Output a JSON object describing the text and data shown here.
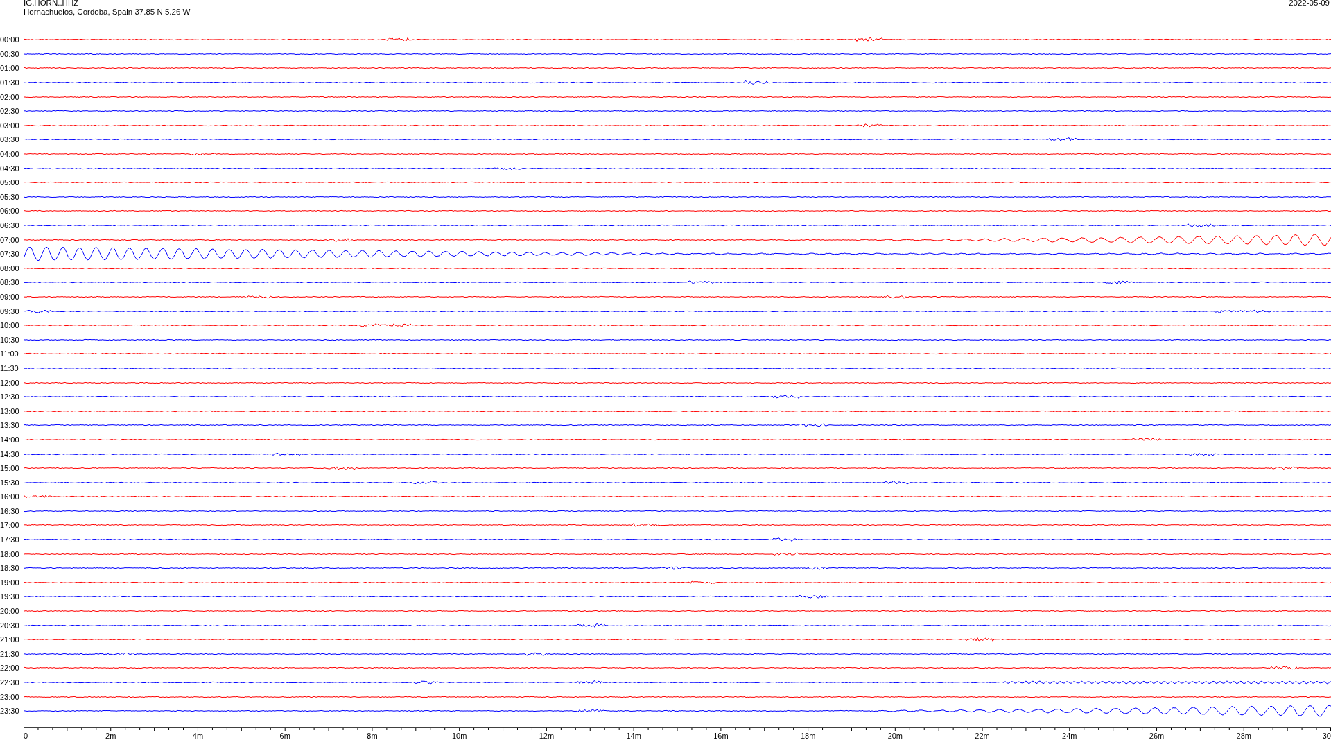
{
  "header": {
    "station": "IG.HORN..HHZ",
    "location": "Hornachuelos, Cordoba, Spain  37.85 N 5.26 W",
    "date": "2022-05-09"
  },
  "rows": [
    {
      "label": "00:00",
      "color": "#ff0000",
      "kind": "quiet"
    },
    {
      "label": "00:30",
      "color": "#0000ff",
      "kind": "quiet"
    },
    {
      "label": "01:00",
      "color": "#ff0000",
      "kind": "quiet"
    },
    {
      "label": "01:30",
      "color": "#0000ff",
      "kind": "quiet"
    },
    {
      "label": "02:00",
      "color": "#ff0000",
      "kind": "quiet"
    },
    {
      "label": "02:30",
      "color": "#0000ff",
      "kind": "quiet"
    },
    {
      "label": "03:00",
      "color": "#ff0000",
      "kind": "quiet"
    },
    {
      "label": "03:30",
      "color": "#0000ff",
      "kind": "quiet"
    },
    {
      "label": "04:00",
      "color": "#ff0000",
      "kind": "quiet"
    },
    {
      "label": "04:30",
      "color": "#0000ff",
      "kind": "quiet"
    },
    {
      "label": "05:00",
      "color": "#ff0000",
      "kind": "quiet"
    },
    {
      "label": "05:30",
      "color": "#0000ff",
      "kind": "quiet"
    },
    {
      "label": "06:00",
      "color": "#ff0000",
      "kind": "quiet"
    },
    {
      "label": "06:30",
      "color": "#0000ff",
      "kind": "quiet"
    },
    {
      "label": "07:00",
      "color": "#ff0000",
      "kind": "rising"
    },
    {
      "label": "07:30",
      "color": "#0000ff",
      "kind": "decaying"
    },
    {
      "label": "08:00",
      "color": "#ff0000",
      "kind": "quiet"
    },
    {
      "label": "08:30",
      "color": "#0000ff",
      "kind": "quiet"
    },
    {
      "label": "09:00",
      "color": "#ff0000",
      "kind": "quiet"
    },
    {
      "label": "09:30",
      "color": "#0000ff",
      "kind": "quiet"
    },
    {
      "label": "10:00",
      "color": "#ff0000",
      "kind": "quiet"
    },
    {
      "label": "10:30",
      "color": "#0000ff",
      "kind": "quiet"
    },
    {
      "label": "11:00",
      "color": "#ff0000",
      "kind": "quiet"
    },
    {
      "label": "11:30",
      "color": "#0000ff",
      "kind": "quiet"
    },
    {
      "label": "12:00",
      "color": "#ff0000",
      "kind": "quiet"
    },
    {
      "label": "12:30",
      "color": "#0000ff",
      "kind": "quiet"
    },
    {
      "label": "13:00",
      "color": "#ff0000",
      "kind": "quiet"
    },
    {
      "label": "13:30",
      "color": "#0000ff",
      "kind": "quiet"
    },
    {
      "label": "14:00",
      "color": "#ff0000",
      "kind": "quiet"
    },
    {
      "label": "14:30",
      "color": "#0000ff",
      "kind": "quiet"
    },
    {
      "label": "15:00",
      "color": "#ff0000",
      "kind": "quiet"
    },
    {
      "label": "15:30",
      "color": "#0000ff",
      "kind": "quiet"
    },
    {
      "label": "16:00",
      "color": "#ff0000",
      "kind": "quiet"
    },
    {
      "label": "16:30",
      "color": "#0000ff",
      "kind": "quiet"
    },
    {
      "label": "17:00",
      "color": "#ff0000",
      "kind": "quiet"
    },
    {
      "label": "17:30",
      "color": "#0000ff",
      "kind": "quiet"
    },
    {
      "label": "18:00",
      "color": "#ff0000",
      "kind": "quiet"
    },
    {
      "label": "18:30",
      "color": "#0000ff",
      "kind": "quiet"
    },
    {
      "label": "19:00",
      "color": "#ff0000",
      "kind": "quiet"
    },
    {
      "label": "19:30",
      "color": "#0000ff",
      "kind": "quiet"
    },
    {
      "label": "20:00",
      "color": "#ff0000",
      "kind": "quiet"
    },
    {
      "label": "20:30",
      "color": "#0000ff",
      "kind": "quiet"
    },
    {
      "label": "21:00",
      "color": "#ff0000",
      "kind": "quiet"
    },
    {
      "label": "21:30",
      "color": "#0000ff",
      "kind": "quiet"
    },
    {
      "label": "22:00",
      "color": "#ff0000",
      "kind": "quiet"
    },
    {
      "label": "22:30",
      "color": "#0000ff",
      "kind": "wobble"
    },
    {
      "label": "23:00",
      "color": "#ff0000",
      "kind": "quiet"
    },
    {
      "label": "23:30",
      "color": "#0000ff",
      "kind": "rising"
    }
  ],
  "axis": {
    "ticks": [
      "0",
      "2m",
      "4m",
      "6m",
      "8m",
      "10m",
      "12m",
      "14m",
      "16m",
      "18m",
      "20m",
      "22m",
      "24m",
      "26m",
      "28m",
      "30"
    ]
  }
}
